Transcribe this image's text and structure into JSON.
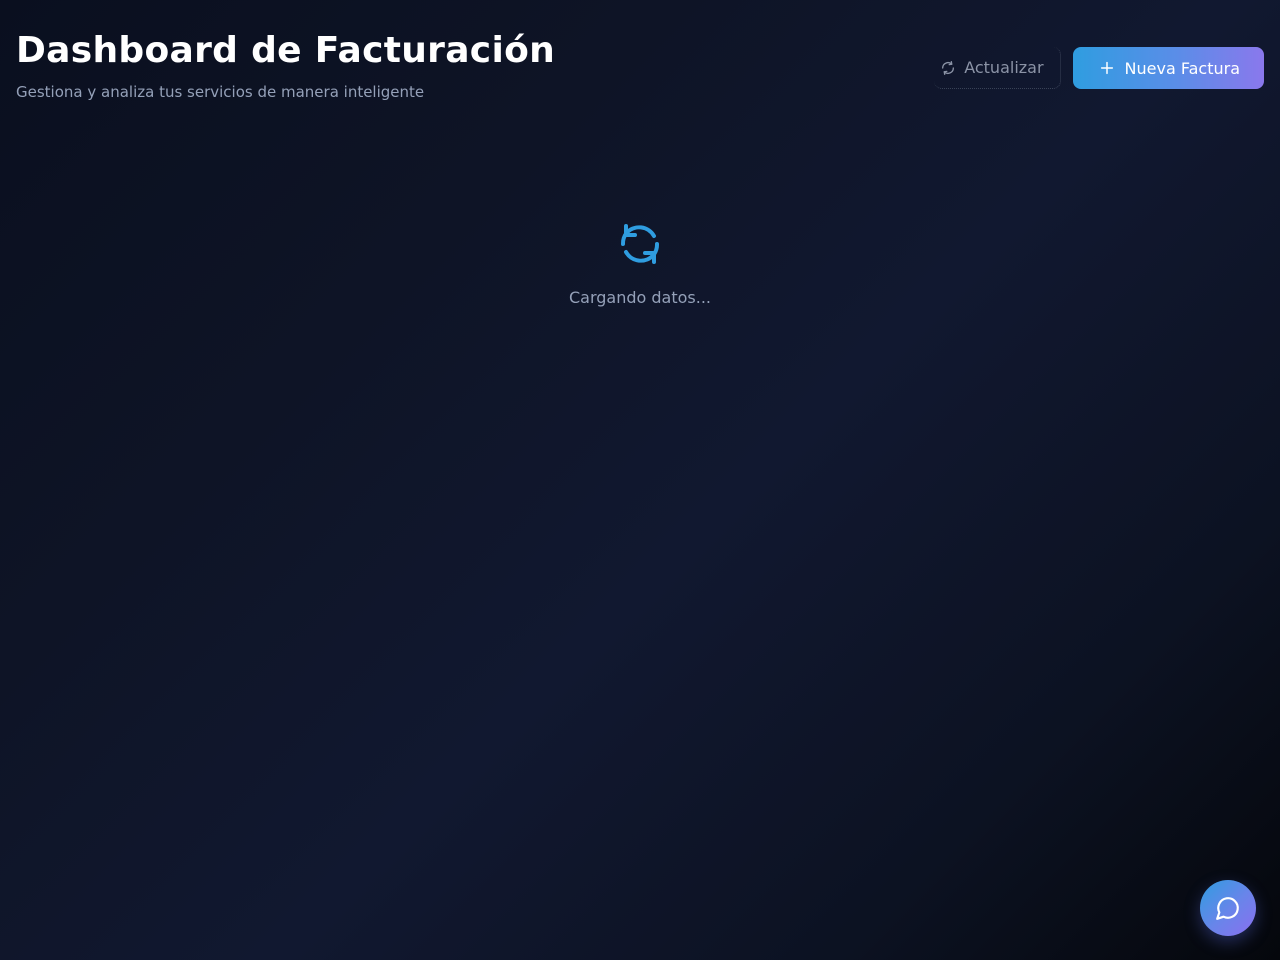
{
  "header": {
    "title": "Dashboard de Facturación",
    "subtitle": "Gestiona y analiza tus servicios de manera inteligente"
  },
  "actions": {
    "refresh_label": "Actualizar",
    "refresh_icon": "refresh-icon",
    "new_invoice_label": "Nueva Factura",
    "new_invoice_icon": "plus-icon"
  },
  "loading": {
    "text": "Cargando datos...",
    "icon": "loading-spinner-icon"
  },
  "chat": {
    "icon": "chat-bubble-icon"
  },
  "colors": {
    "accent_blue": "#2f9de0",
    "accent_violet": "#8a78ec",
    "muted_text": "#94a0b8",
    "background": "#0e1426"
  }
}
